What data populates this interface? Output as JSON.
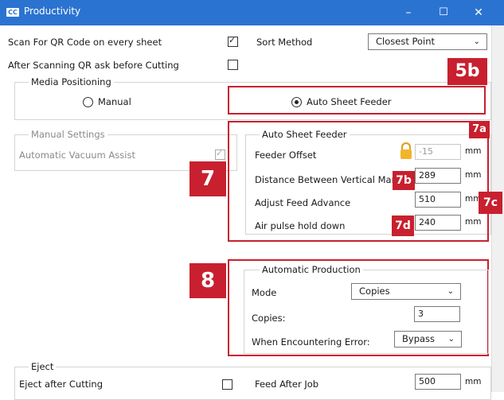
{
  "window": {
    "app_icon": "CC",
    "title": "Productivity",
    "minimize": "–",
    "maximize": "☐",
    "close": "✕"
  },
  "top": {
    "scan_qr_label": "Scan For QR Code on every sheet",
    "scan_qr_checked": true,
    "sort_method_label": "Sort Method",
    "sort_method_value": "Closest Point",
    "after_scan_label": "After Scanning QR ask before Cutting",
    "after_scan_checked": false
  },
  "media": {
    "legend": "Media Positioning",
    "manual_label": "Manual",
    "auto_label": "Auto Sheet Feeder",
    "selected": "Auto Sheet Feeder"
  },
  "manual_settings": {
    "legend": "Manual Settings",
    "vacuum_label": "Automatic Vacuum Assist",
    "vacuum_checked": true
  },
  "auto_feeder": {
    "legend": "Auto Sheet Feeder",
    "feeder_offset_label": "Feeder Offset",
    "feeder_offset_value": "-15",
    "distance_label": "Distance Between Vertical Marks",
    "distance_value": "289",
    "adjust_label": "Adjust Feed Advance",
    "adjust_value": "510",
    "air_label": "Air pulse hold down",
    "air_value": "240",
    "unit": "mm"
  },
  "production": {
    "legend": "Automatic Production",
    "mode_label": "Mode",
    "mode_value": "Copies",
    "copies_label": "Copies:",
    "copies_value": "3",
    "error_label": "When Encountering Error:",
    "error_value": "Bypass"
  },
  "eject": {
    "legend": "Eject",
    "after_cutting_label": "Eject after Cutting",
    "after_cutting_checked": false,
    "feed_after_job_label": "Feed After Job",
    "feed_after_job_value": "500",
    "unit": "mm"
  },
  "callouts": {
    "c5b": "5b",
    "c7": "7",
    "c7a": "7a",
    "c7b": "7b",
    "c7c": "7c",
    "c7d": "7d",
    "c8": "8"
  },
  "colors": {
    "titlebar": "#2b73d1",
    "callout_red": "#c8202f"
  }
}
